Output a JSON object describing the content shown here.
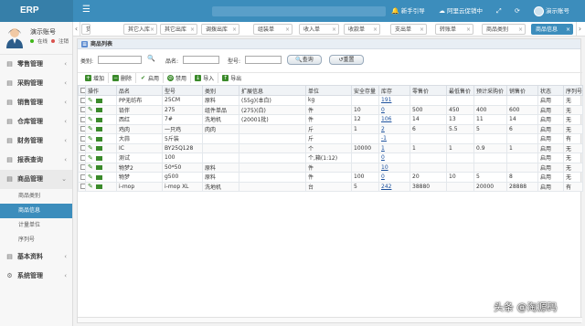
{
  "app": {
    "title": "ERP"
  },
  "topbar": {
    "items": [
      {
        "icon": "bell-icon",
        "label": "新手引导"
      },
      {
        "icon": "cloud-icon",
        "label": "阿里云促销中"
      },
      {
        "icon": "expand-icon",
        "label": ""
      },
      {
        "icon": "refresh-icon",
        "label": ""
      },
      {
        "icon": "user-avatar",
        "label": "演示账号"
      }
    ]
  },
  "user": {
    "name": "演示账号",
    "online": "在线",
    "logout": "注销"
  },
  "sidebar": {
    "items": [
      {
        "label": "零售管理",
        "icon": "cart-icon"
      },
      {
        "label": "采购管理",
        "icon": "truck-icon"
      },
      {
        "label": "销售管理",
        "icon": "sales-icon"
      },
      {
        "label": "仓库管理",
        "icon": "warehouse-icon"
      },
      {
        "label": "财务管理",
        "icon": "finance-icon"
      },
      {
        "label": "报表查询",
        "icon": "report-icon"
      },
      {
        "label": "商品管理",
        "icon": "goods-icon"
      }
    ],
    "sub_items": [
      "商品类别",
      "商品信息",
      "计量单位",
      "序列号"
    ],
    "after_items": [
      {
        "label": "基本资料",
        "icon": "basic-icon"
      },
      {
        "label": "系统管理",
        "icon": "system-icon"
      }
    ]
  },
  "tabs": [
    "货",
    "其它入库",
    "其它出库",
    "调拨出库",
    "组装单",
    "收入单",
    "收款单",
    "支出单",
    "转账单",
    "商品类别",
    "商品信息"
  ],
  "panel": {
    "title": "商品列表"
  },
  "filters": {
    "category_label": "类别:",
    "name_label": "品名:",
    "model_label": "型号:",
    "search_btn": "查询",
    "reset_btn": "重置"
  },
  "toolbar": {
    "add": "增加",
    "delete": "删除",
    "enable": "启用",
    "disable": "禁用",
    "import": "导入",
    "export": "导出"
  },
  "table": {
    "columns": [
      "操作",
      "品名",
      "型号",
      "类别",
      "扩展信息",
      "单位",
      "安全存量",
      "库存",
      "零售价",
      "最低售价",
      "预计采购价",
      "销售价",
      "状态",
      "序列号"
    ],
    "rows": [
      [
        "PP无纺布",
        "25CM",
        "原料",
        "(55g)(本白)",
        "kg",
        "",
        "191",
        "",
        "",
        "",
        "",
        "启用",
        "无"
      ],
      [
        "铅伴",
        "275",
        "组件单品",
        "(275)(白)",
        "件",
        "10",
        "0",
        "500",
        "450",
        "400",
        "600",
        "启用",
        "无"
      ],
      [
        "西红",
        "7#",
        "洗地机",
        "(20001批)",
        "件",
        "12",
        "106",
        "14",
        "13",
        "11",
        "14",
        "启用",
        "无"
      ],
      [
        "鸡肉",
        "一只鸡",
        "肉肉",
        "",
        "斤",
        "1",
        "2",
        "6",
        "5.5",
        "5",
        "6",
        "启用",
        "无"
      ],
      [
        "大蒜",
        "5斤装",
        "",
        "",
        "斤",
        "",
        "-1",
        "",
        "",
        "",
        "",
        "启用",
        "有"
      ],
      [
        "IC",
        "BY25Q128",
        "",
        "",
        "个",
        "10000",
        "1",
        "1",
        "1",
        "0.9",
        "1",
        "启用",
        "无"
      ],
      [
        "测试",
        "100",
        "",
        "",
        "个,箱(1:12)",
        "",
        "0",
        "",
        "",
        "",
        "",
        "启用",
        "无"
      ],
      [
        "物梦2",
        "50*50",
        "原料",
        "",
        "件",
        "",
        "10",
        "",
        "",
        "",
        "",
        "启用",
        "无"
      ],
      [
        "物梦",
        "g500",
        "原料",
        "",
        "件",
        "100",
        "0",
        "20",
        "10",
        "5",
        "8",
        "启用",
        "无"
      ],
      [
        "i-mop",
        "i-mop XL",
        "洗地机",
        "",
        "台",
        "5",
        "242",
        "38880",
        "",
        "20000",
        "28888",
        "启用",
        "有"
      ]
    ]
  },
  "watermark": "头条 @淘源码",
  "colors": {
    "topbar": "#3c8dbc",
    "logo_bg": "#367fa9",
    "active_tab": "#3c8dbc",
    "link": "#1a4f9c",
    "edit_icon": "#3a8a2a"
  }
}
